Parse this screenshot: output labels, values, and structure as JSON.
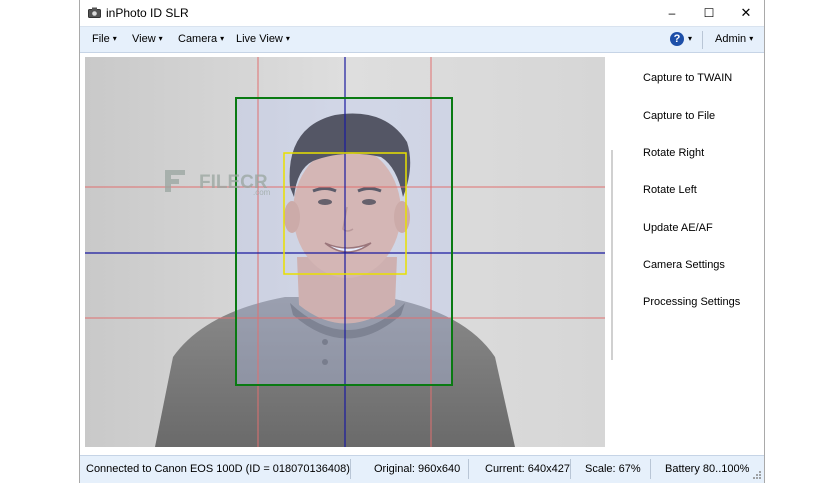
{
  "window": {
    "title": "inPhoto ID SLR"
  },
  "menu": {
    "file": "File",
    "view": "View",
    "camera": "Camera",
    "live_view": "Live View",
    "help_icon": "question-circle",
    "admin": "Admin"
  },
  "window_controls": {
    "minimize": "–",
    "maximize": "☐",
    "close": "✕"
  },
  "viewer": {
    "watermark": "FILECR",
    "watermark_suffix": ".com"
  },
  "side_panel": {
    "buttons": [
      "Capture to TWAIN",
      "Capture to File",
      "Rotate Right",
      "Rotate Left",
      "Update AE/AF",
      "Camera Settings",
      "Processing Settings"
    ]
  },
  "status": {
    "connection": "Connected to Canon EOS 100D (ID = 018070136408)",
    "original": "Original: 960x640",
    "current": "Current: 640x427",
    "scale": "Scale: 67%",
    "battery": "Battery 80..100%"
  },
  "colors": {
    "menubar_bg": "#e6f0fb",
    "outer_frame": "#0a7a12",
    "face_frame": "#e8e000",
    "center_line": "#1a1aa0",
    "guide_line": "#e07070"
  }
}
